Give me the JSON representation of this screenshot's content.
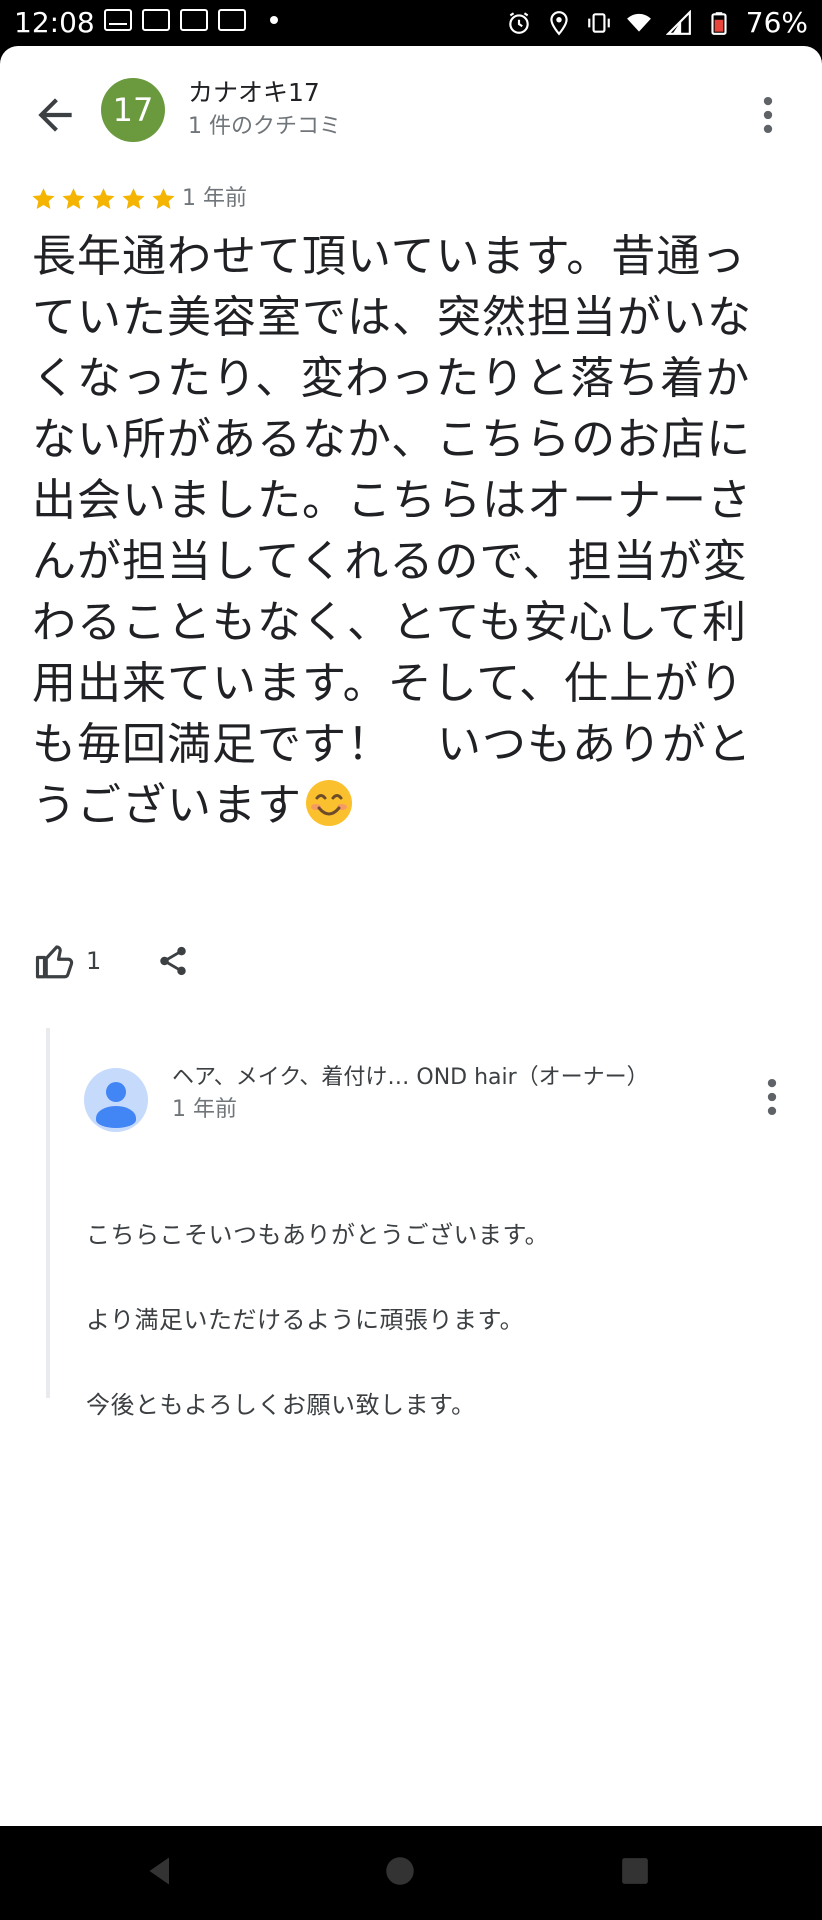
{
  "status_bar": {
    "time": "12:08",
    "battery": "76%",
    "left_icons": [
      "mail-icon",
      "au-notification-icon",
      "au-notification-icon",
      "au-notification-icon",
      "dot-icon"
    ],
    "right_icons": [
      "alarm-icon",
      "location-icon",
      "vibrate-icon",
      "wifi-icon",
      "signal-icon",
      "battery-icon"
    ]
  },
  "review": {
    "avatar_text": "17",
    "avatar_color": "#6a9a3d",
    "reviewer_name": "カナオキ17",
    "reviewer_review_count": "1 件のクチコミ",
    "rating": 5,
    "star_color": "#f4b400",
    "time": "1 年前",
    "text": "長年通わせて頂いています。昔通っていた美容室では、突然担当がいなくなったり、変わったりと落ち着かない所があるなか、こちらのお店に出会いました。こちらはオーナーさんが担当してくれるので、担当が変わることもなく、とても安心して利用出来ています。そして、仕上がりも毎回満足です！　いつもありがとうございます",
    "emoji": "smiling-face-emoji",
    "like_count": "1"
  },
  "owner_reply": {
    "name": "ヘア、メイク、着付け… OND hair（オーナー）",
    "time": "1 年前",
    "lines": [
      "こちらこそいつもありがとうございます。",
      "より満足いただけるように頑張ります。",
      "今後ともよろしくお願い致します。"
    ]
  },
  "navigation_bar": {
    "buttons": [
      "back-triangle-icon",
      "home-circle-icon",
      "recents-square-icon"
    ]
  }
}
